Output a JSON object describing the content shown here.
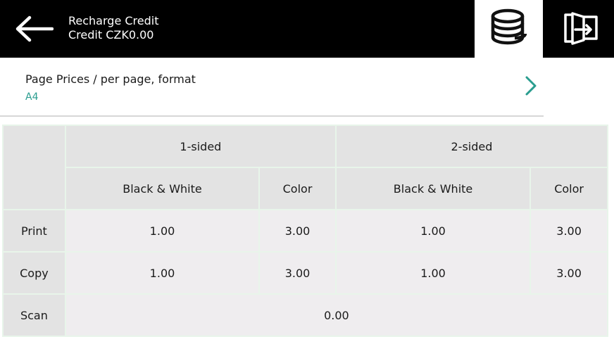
{
  "header": {
    "title": "Recharge Credit",
    "credit": "Credit CZK0.00"
  },
  "price_selector": {
    "label": "Page Prices / per page, format",
    "value": "A4"
  },
  "table": {
    "sides": [
      "1-sided",
      "2-sided"
    ],
    "modes": [
      "Black & White",
      "Color",
      "Black & White",
      "Color"
    ],
    "rows": [
      {
        "label": "Print",
        "values": [
          "1.00",
          "3.00",
          "1.00",
          "3.00"
        ]
      },
      {
        "label": "Copy",
        "values": [
          "1.00",
          "3.00",
          "1.00",
          "3.00"
        ]
      }
    ],
    "scan": {
      "label": "Scan",
      "value": "0.00"
    }
  },
  "icons": {
    "back": "arrow-left-icon",
    "coins": "coins-icon",
    "exit": "exit-door-icon",
    "chevron": "chevron-right-icon"
  },
  "colors": {
    "topbar": "#000000",
    "accent": "#2a9d8f",
    "header_cell": "#e3e3e3",
    "value_cell": "#efedef",
    "grid": "#e8f5ea"
  }
}
